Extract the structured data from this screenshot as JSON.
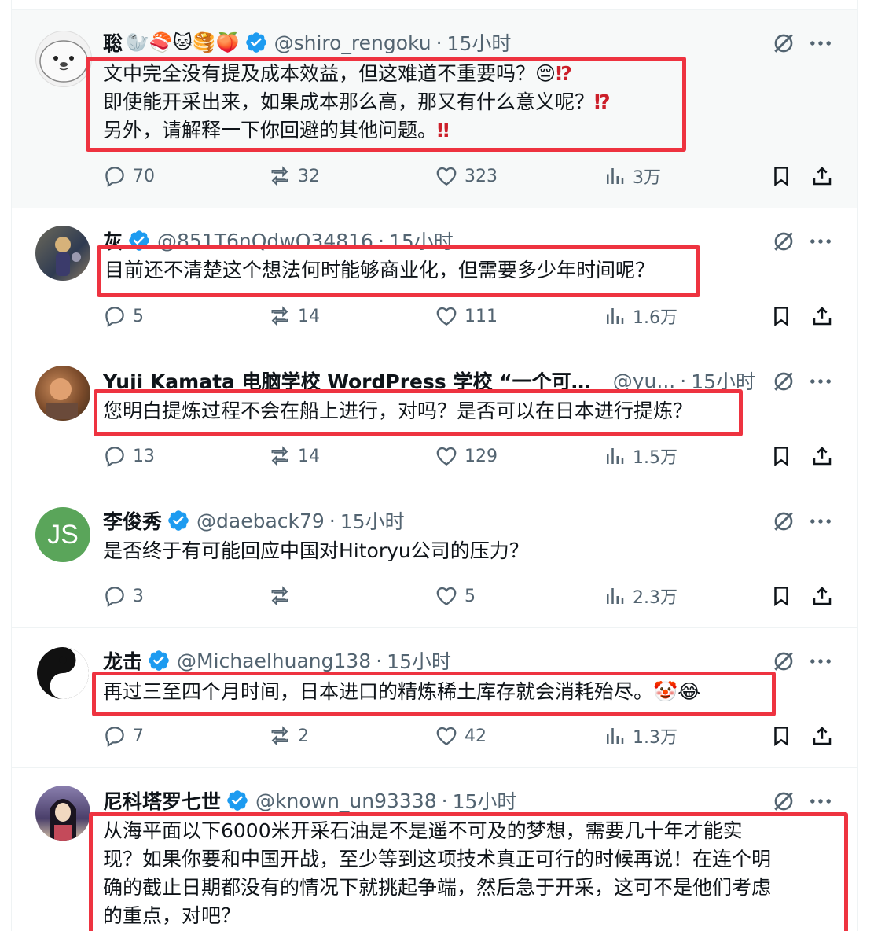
{
  "tweets": [
    {
      "name": "聡",
      "name_emojis": "🦭🍣🐱🥞🍑",
      "handle": "@shiro_rengoku",
      "time": "15小时",
      "lines": [
        {
          "text": "文中完全没有提及成本效益，但这难道不重要吗？😔",
          "mark": "⁉"
        },
        {
          "text": "即使能开采出来，如果成本那么高，那又有什么意义呢？",
          "mark": "⁉"
        },
        {
          "text": "另外，请解释一下你回避的其他问题。",
          "mark": "‼"
        }
      ],
      "stats": {
        "replies": "70",
        "reposts": "32",
        "likes": "323",
        "views": "3万"
      }
    },
    {
      "name": "灰",
      "handle": "@851T6nQdwO34816",
      "time": "15小时",
      "text": "目前还不清楚这个想法何时能够商业化，但需要多少年时间呢？",
      "stats": {
        "replies": "5",
        "reposts": "14",
        "likes": "111",
        "views": "1.6万"
      }
    },
    {
      "name": "Yuji Kamata 电脑学校 WordPress 学校 “一个可以...",
      "handle": "@yu...",
      "time": "15小时",
      "text": "您明白提炼过程不会在船上进行，对吗？是否可以在日本进行提炼？",
      "stats": {
        "replies": "13",
        "reposts": "14",
        "likes": "129",
        "views": "1.5万"
      }
    },
    {
      "name": "李俊秀",
      "avatar_initials": "JS",
      "handle": "@daeback79",
      "time": "15小时",
      "text": "是否终于有可能回应中国对Hitoryu公司的压力？",
      "stats": {
        "replies": "3",
        "reposts": "",
        "likes": "5",
        "views": "2.3万"
      }
    },
    {
      "name": "龙击",
      "handle": "@Michaelhuang138",
      "time": "15小时",
      "text": "再过三至四个月时间，日本进口的精炼稀土库存就会消耗殆尽。🤡😂",
      "stats": {
        "replies": "7",
        "reposts": "2",
        "likes": "42",
        "views": "1.3万"
      }
    },
    {
      "name": "尼科塔罗七世",
      "handle": "@known_un93338",
      "time": "15小时",
      "lines": [
        "从海平面以下6000米开采石油是不是遥不可及的梦想，需要几十年才能实",
        "现？如果你要和中国开战，至少等到这项技术真正可行的时候再说！在连个明",
        "确的截止日期都没有的情况下就挑起争端，然后急于开采，这可不是他们考虑",
        "的重点，对吧？"
      ]
    }
  ],
  "colors": {
    "verified": "#1d9bf0",
    "highlight": "#ee3340",
    "muted": "#536471",
    "avatar_js": "#5aa55a"
  },
  "icons": [
    "reply-icon",
    "repost-icon",
    "like-icon",
    "views-icon",
    "bookmark-icon",
    "share-icon",
    "grok-icon",
    "more-icon",
    "verified-icon"
  ]
}
